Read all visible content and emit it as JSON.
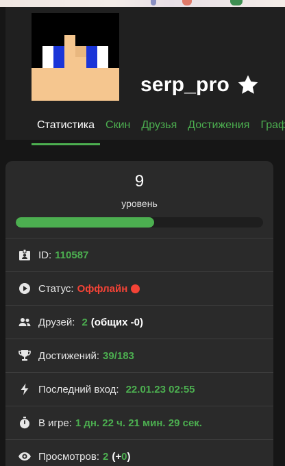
{
  "profile": {
    "username": "serp_pro",
    "favorite_icon": "star-icon"
  },
  "tabs": [
    {
      "label": "Статистика",
      "active": true
    },
    {
      "label": "Скин",
      "active": false
    },
    {
      "label": "Друзья",
      "active": false
    },
    {
      "label": "Достижения",
      "active": false
    },
    {
      "label": "Граф",
      "active": false
    }
  ],
  "level": {
    "value": "9",
    "label": "уровень",
    "progress_fraction": 0.56
  },
  "stats": {
    "id_label": "ID:",
    "id_value": "110587",
    "status_label": "Статус:",
    "status_value": "Оффлайн",
    "friends_label": "Друзей:",
    "friends_value": "2",
    "friends_common_prefix": "(общих - ",
    "friends_common_value": "0",
    "friends_common_suffix": ")",
    "achievements_label": "Достижений:",
    "achievements_value": "39/183",
    "last_login_label": "Последний вход:",
    "last_login_value": "22.01.23 02:55",
    "playtime_label": "В игре:",
    "playtime_value": "1 дн. 22 ч. 21 мин. 29 сек.",
    "views_label": "Просмотров:",
    "views_value": "2",
    "views_delta_prefix": "(+",
    "views_delta_value": "0",
    "views_delta_suffix": ")"
  },
  "colors": {
    "accent": "#4caf50",
    "offline": "#f44336",
    "background": "#161616",
    "card": "#2a2a2a"
  }
}
